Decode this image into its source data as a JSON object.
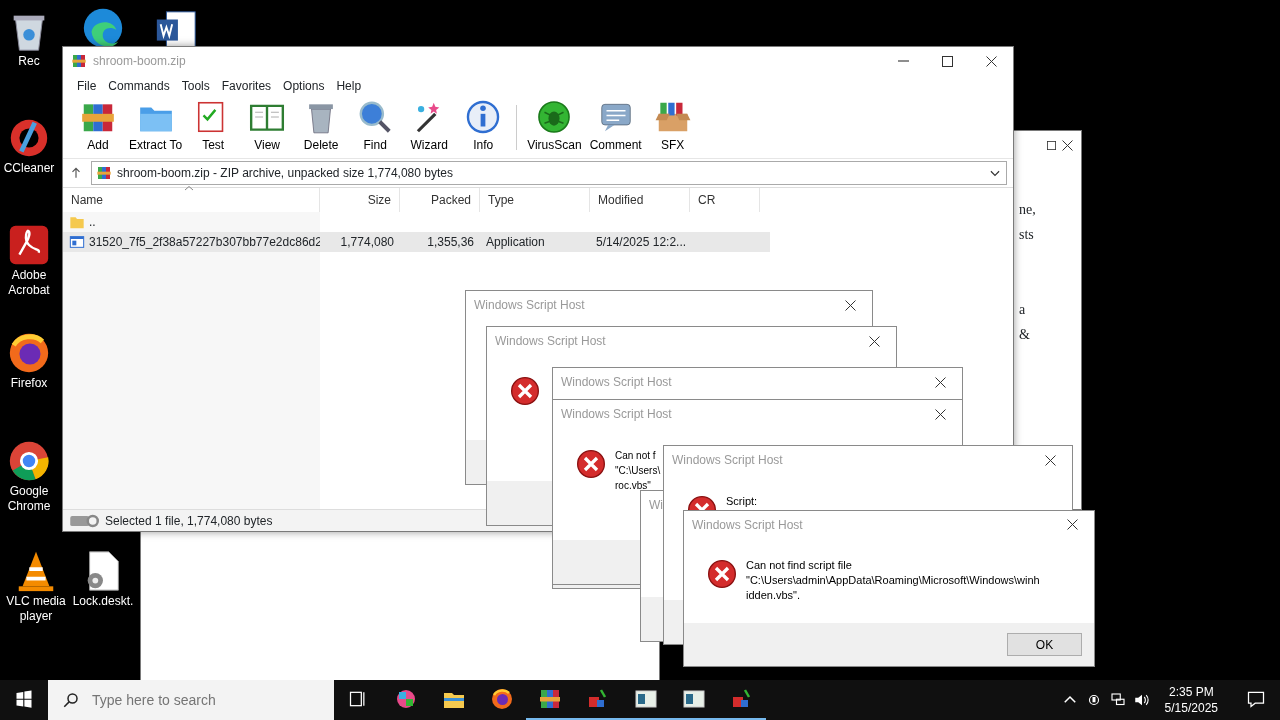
{
  "desktop_icons": [
    {
      "kind": "recycle",
      "label": "Rec"
    },
    {
      "kind": "ccleaner",
      "label": "CCleaner"
    },
    {
      "kind": "acrobat",
      "label": "Adobe Acrobat"
    },
    {
      "kind": "firefox",
      "label": "Firefox"
    },
    {
      "kind": "chrome",
      "label": "Google Chrome"
    },
    {
      "kind": "vlc",
      "label": "VLC media player"
    },
    {
      "kind": "edge"
    },
    {
      "kind": "word"
    },
    {
      "kind": "file",
      "label": "Lock.deskt."
    }
  ],
  "background_window": {
    "fragments": [
      "ne,",
      "sts",
      "a",
      "&"
    ]
  },
  "archiver": {
    "title": "shroom-boom.zip",
    "menu": [
      "File",
      "Commands",
      "Tools",
      "Favorites",
      "Options",
      "Help"
    ],
    "toolbar": [
      {
        "kind": "add",
        "label": "Add"
      },
      {
        "kind": "extract",
        "label": "Extract To"
      },
      {
        "kind": "test",
        "label": "Test"
      },
      {
        "kind": "view",
        "label": "View"
      },
      {
        "kind": "delete",
        "label": "Delete"
      },
      {
        "kind": "find",
        "label": "Find"
      },
      {
        "kind": "wizard",
        "label": "Wizard"
      },
      {
        "kind": "info",
        "label": "Info"
      },
      {
        "kind": "virus",
        "label": "VirusScan"
      },
      {
        "kind": "comment",
        "label": "Comment"
      },
      {
        "kind": "sfx",
        "label": "SFX"
      }
    ],
    "path": "shroom-boom.zip - ZIP archive, unpacked size 1,774,080 bytes",
    "columns": [
      "Name",
      "Size",
      "Packed",
      "Type",
      "Modified",
      "CR"
    ],
    "rows": [
      {
        "kind": "folder",
        "name": "..",
        "selected": false
      },
      {
        "kind": "file",
        "name": "31520_7f5_2f38a57227b307bb77e2dc86d2",
        "size": "1,774,080",
        "packed": "1,355,36",
        "type": "Application",
        "modified": "5/14/2025 12:2...",
        "selected": true
      }
    ],
    "status": "Selected 1 file, 1,774,080 bytes"
  },
  "dialogs": [
    {
      "kind": "plain",
      "title": "Windows Script Host"
    },
    {
      "kind": "error",
      "title": "Windows Script Host"
    },
    {
      "kind": "plain",
      "title": "Windows Script Host"
    },
    {
      "kind": "error",
      "title": "Windows Script Host",
      "lines": [
        "Can not f",
        "\"C:\\Users\\",
        "roc.vbs\""
      ]
    },
    {
      "kind": "plain",
      "title": "Wi"
    },
    {
      "kind": "error",
      "title": "Windows Script Host",
      "lines": [
        "Script:"
      ]
    },
    {
      "kind": "error",
      "title": "Windows Script Host",
      "lines": [
        "Can not find script file",
        "\"C:\\Users\\admin\\AppData\\Roaming\\Microsoft\\Windows\\winh",
        "idden.vbs\"."
      ],
      "button": "OK"
    }
  ],
  "taskbar": {
    "search_placeholder": "Type here to search",
    "apps": [
      {
        "kind": "colorful",
        "running": false
      },
      {
        "kind": "explorer",
        "running": false
      },
      {
        "kind": "firefox",
        "running": false
      },
      {
        "kind": "winrar",
        "running": true
      },
      {
        "kind": "paint",
        "running": true
      },
      {
        "kind": "window",
        "running": true
      },
      {
        "kind": "window",
        "running": true
      },
      {
        "kind": "paint",
        "running": true
      }
    ],
    "time": "2:35 PM",
    "date": "5/15/2025"
  }
}
